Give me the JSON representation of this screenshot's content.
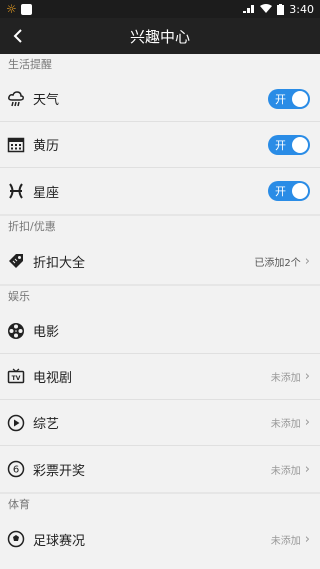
{
  "status_bar": {
    "time": "3:40"
  },
  "header": {
    "title": "兴趣中心"
  },
  "sections": [
    {
      "title": "生活提醒",
      "items": [
        {
          "label": "天气",
          "icon": "weather-icon",
          "toggle": "开"
        },
        {
          "label": "黄历",
          "icon": "calendar-icon",
          "toggle": "开"
        },
        {
          "label": "星座",
          "icon": "zodiac-icon",
          "toggle": "开"
        }
      ]
    },
    {
      "title": "折扣/优惠",
      "items": [
        {
          "label": "折扣大全",
          "icon": "tag-icon",
          "meta": "已添加2个"
        }
      ]
    },
    {
      "title": "娱乐",
      "items": [
        {
          "label": "电影",
          "icon": "film-reel-icon"
        },
        {
          "label": "电视剧",
          "icon": "tv-icon",
          "meta": "未添加"
        },
        {
          "label": "综艺",
          "icon": "play-icon",
          "meta": "未添加"
        },
        {
          "label": "彩票开奖",
          "icon": "lottery-icon",
          "meta": "未添加"
        }
      ]
    },
    {
      "title": "体育",
      "items": [
        {
          "label": "足球赛况",
          "icon": "soccer-icon",
          "meta": "未添加"
        }
      ]
    }
  ],
  "colors": {
    "toggle_on": "#2a8ce6",
    "header_bg": "#222222",
    "status_bg": "#1c1c1c"
  }
}
